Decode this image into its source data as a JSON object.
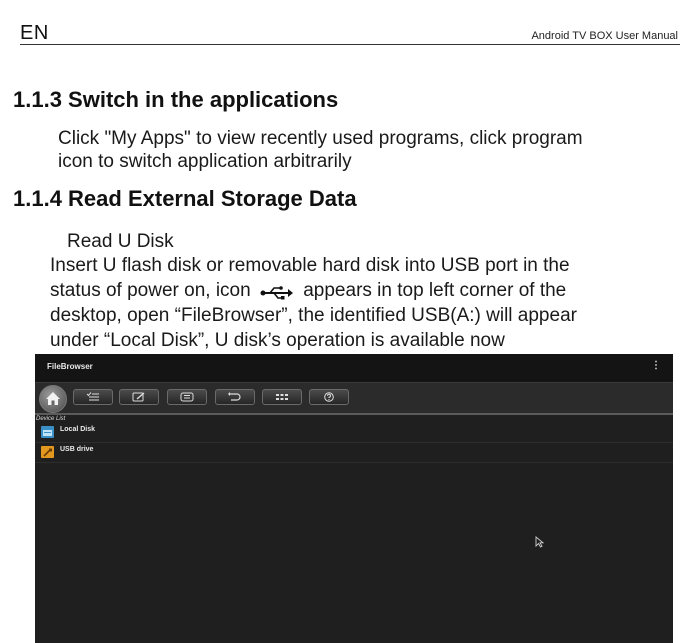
{
  "header": {
    "lang": "EN",
    "title": "Android TV BOX User Manual"
  },
  "section_113": {
    "heading": "1.1.3 Switch in the applications",
    "line1": "Click \"My Apps\" to view recently used programs, click program",
    "line2": "icon to switch application arbitrarily"
  },
  "section_114": {
    "heading": "1.1.4 Read External Storage Data",
    "subtitle": "Read U Disk",
    "line1": "Insert U flash disk or removable hard disk into USB port in the",
    "line2_before": "status of power on, icon",
    "line2_after": "appears in top left corner of the",
    "line3": "desktop, open “FileBrowser”, the identified USB(A:) will appear",
    "line4": "under “Local Disk”, U disk’s operation is available now"
  },
  "filebrowser": {
    "title": "FileBrowser",
    "menu_glyph": "⋮",
    "list_header": "Device List",
    "items": [
      {
        "label": "Local Disk",
        "icon": "local-disk-icon",
        "color": "#3a8fc4"
      },
      {
        "label": "USB drive",
        "icon": "usb-drive-icon",
        "color": "#e2981e"
      }
    ],
    "toolbar_icons": [
      "home-icon",
      "multi-select-icon",
      "edit-icon",
      "list-icon",
      "back-icon",
      "grid-icon",
      "help-icon"
    ]
  }
}
